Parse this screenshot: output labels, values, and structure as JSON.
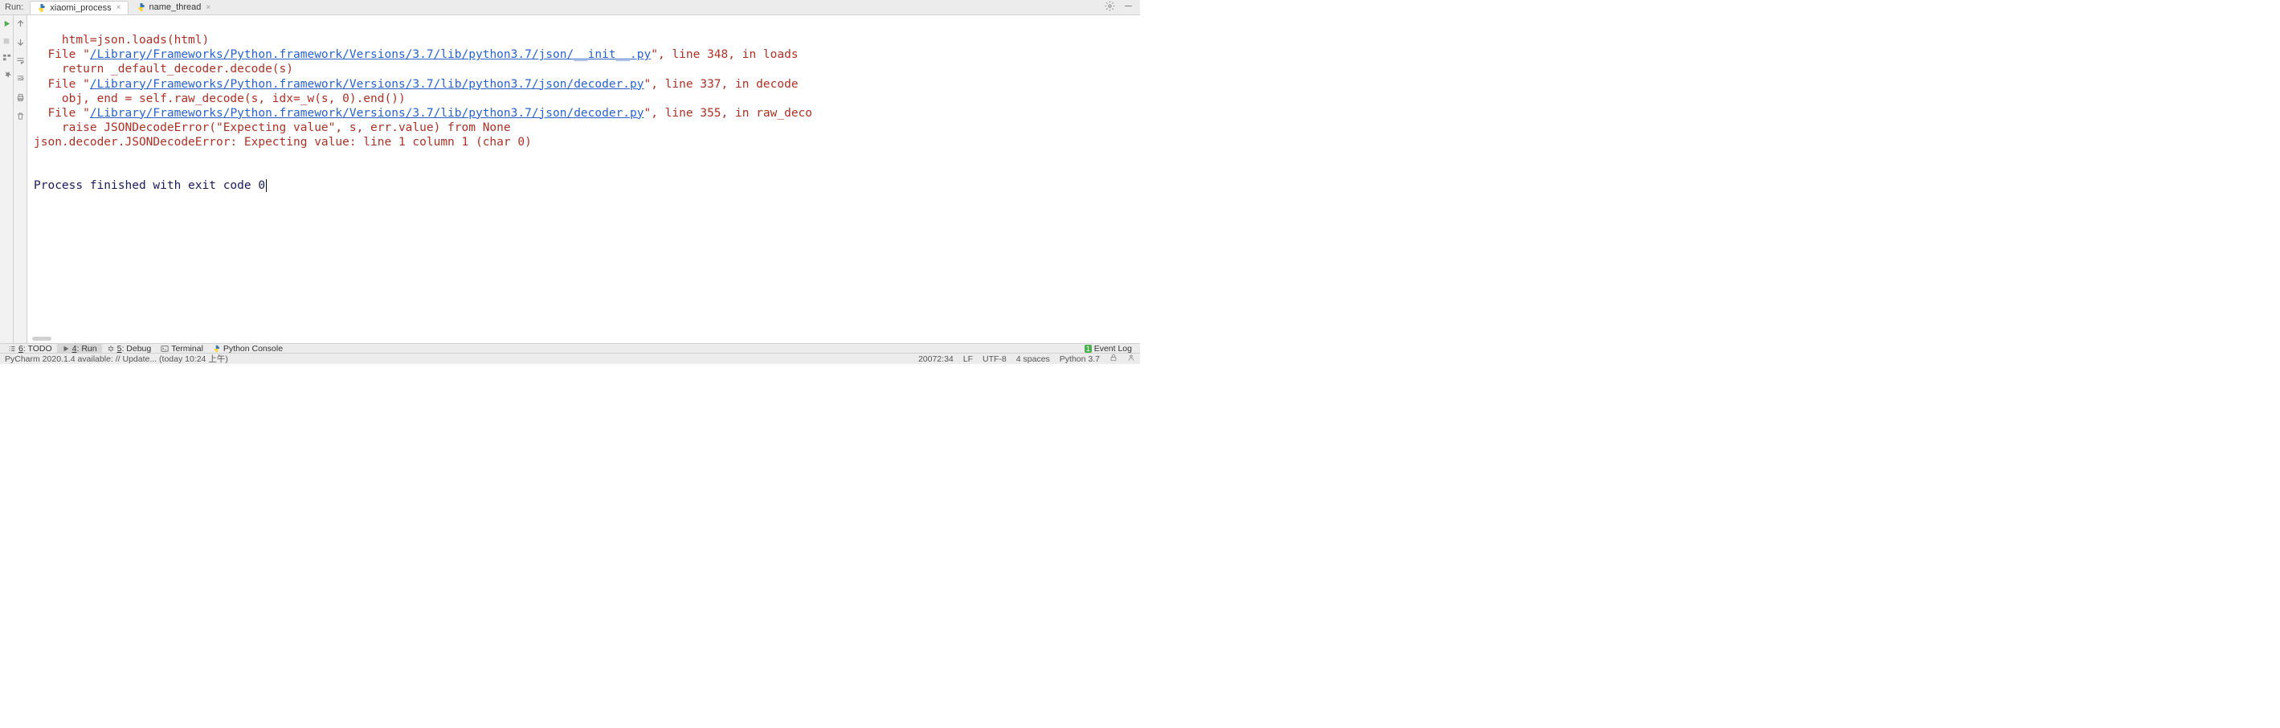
{
  "header": {
    "run_label": "Run:",
    "tabs": [
      {
        "label": "xiaomi_process"
      },
      {
        "label": "name_thread"
      }
    ]
  },
  "console": {
    "line0": "    html=json.loads(html)",
    "file_prefix": "  File \"",
    "trace1_link": "/Library/Frameworks/Python.framework/Versions/3.7/lib/python3.7/json/__init__.py",
    "trace1_suffix": "\", line 348, in loads",
    "trace1_code": "    return _default_decoder.decode(s)",
    "trace2_link": "/Library/Frameworks/Python.framework/Versions/3.7/lib/python3.7/json/decoder.py",
    "trace2_suffix": "\", line 337, in decode",
    "trace2_code": "    obj, end = self.raw_decode(s, idx=_w(s, 0).end())",
    "trace3_link": "/Library/Frameworks/Python.framework/Versions/3.7/lib/python3.7/json/decoder.py",
    "trace3_suffix": "\", line 355, in raw_deco",
    "trace3_code": "    raise JSONDecodeError(\"Expecting value\", s, err.value) from None",
    "error_line": "json.decoder.JSONDecodeError: Expecting value: line 1 column 1 (char 0)",
    "finished": "Process finished with exit code 0"
  },
  "bottom_tools": {
    "todo": {
      "num": "6",
      "label": ": TODO"
    },
    "run": {
      "num": "4",
      "label": ": Run"
    },
    "debug": {
      "num": "5",
      "label": ": Debug"
    },
    "terminal": "Terminal",
    "python_console": "Python Console",
    "event_log_badge": "1",
    "event_log": "Event Log"
  },
  "status": {
    "update_msg": "PyCharm 2020.1.4 available: // Update... (today 10:24 上午)",
    "pos": "20072:34",
    "line_sep": "LF",
    "encoding": "UTF-8",
    "indent": "4 spaces",
    "python": "Python 3.7"
  }
}
